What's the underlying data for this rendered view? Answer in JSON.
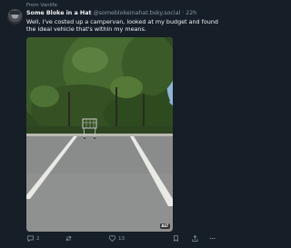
{
  "post": {
    "feed_context": "From Vanlife",
    "author": {
      "display_name": "Some Bloke in a Hat",
      "handle": "@someblokeinahat.bsky.social",
      "separator": " · ",
      "time": "22h"
    },
    "text": "Well, I've costed up a campervan, looked at my budget and found the ideal vehicle that's within my means.",
    "image": {
      "badge": "ALT"
    },
    "actions": {
      "reply_count": "2",
      "repost_icon": "repost-icon",
      "like_count": "13",
      "bookmark_icon": "bookmark-icon",
      "share_icon": "share-icon",
      "more_icon": "more-icon"
    }
  },
  "colors": {
    "background": "#161e27",
    "text": "#f1f3f5",
    "muted": "#8b98a5"
  }
}
